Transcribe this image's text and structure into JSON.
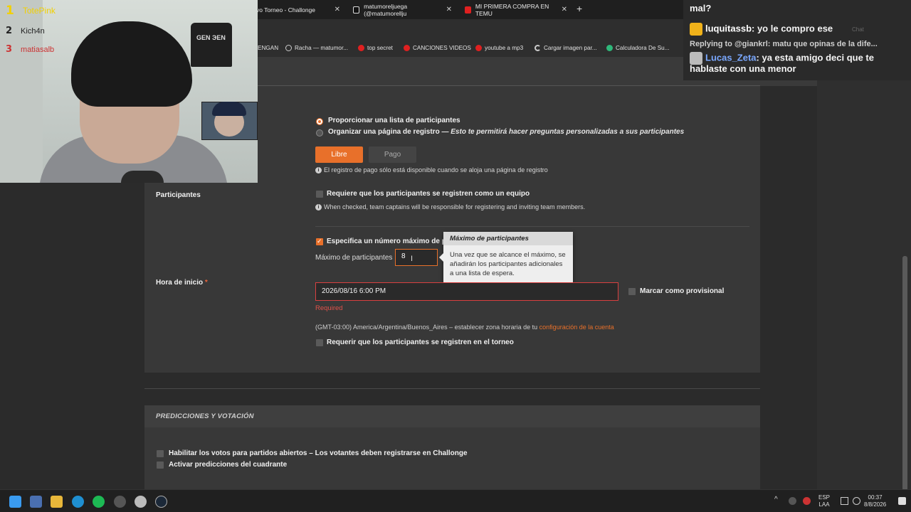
{
  "browser": {
    "tabs": [
      {
        "label": "vo Torneo - Challonge"
      },
      {
        "label": "matumoreljuega (@matumorellju"
      },
      {
        "label": "MI PRIMERA COMPRA EN TEMU"
      }
    ],
    "bookmarks": [
      {
        "label": "ENGAN"
      },
      {
        "label": "Racha — matumor..."
      },
      {
        "label": "top secret"
      },
      {
        "label": "CANCIONES VIDEOS"
      },
      {
        "label": "youtube a mp3"
      },
      {
        "label": "Cargar imagen par..."
      },
      {
        "label": "Calculadora De Su..."
      }
    ]
  },
  "form": {
    "participants_label": "Participantes",
    "radio_list": "Proporcionar una lista de participantes",
    "radio_reg_main": "Organizar una página de registro — ",
    "radio_reg_em": "Esto te permitirá hacer preguntas personalizadas a sus participantes",
    "btn_libre": "Libre",
    "btn_pago": "Pago",
    "pago_info": "El registro de pago sólo está disponible cuando se aloja una página de registro",
    "team_checkbox": "Requiere que los participantes se registren como un equipo",
    "team_info": "When checked, team captains will be responsible for registering and inviting team members.",
    "max_checkbox": "Especifica un número máximo de pa",
    "max_label": "Máximo de participantes",
    "max_value": "8",
    "tooltip_title": "Máximo de participantes",
    "tooltip_body": "Una vez que se alcance el máximo, se añadirán los participantes adicionales a una lista de espera.",
    "start_label": "Hora de inicio",
    "start_star": "*",
    "start_value": "2026/08/16 6:00 PM",
    "provisional": "Marcar como provisional",
    "required_msg": "Required",
    "tz_text": "(GMT-03:00) America/Argentina/Buenos_Aires – establecer zona horaria de tu ",
    "tz_link": "configuración de la cuenta",
    "register_checkbox": "Requerir que los participantes se registren en el torneo"
  },
  "predictions": {
    "title": "PREDICCIONES Y VOTACIÓN",
    "opt1": "Habilitar los votos para partidos abiertos – Los votantes deben registrarse en Challonge",
    "opt2": "Activar predicciones del cuadrante"
  },
  "overlay": {
    "leaderboard": [
      {
        "rank": "1",
        "name": "TotePink"
      },
      {
        "rank": "2",
        "name": "Kich4n"
      },
      {
        "rank": "3",
        "name": "matiasalb"
      }
    ],
    "shirt_text": "GEN ЭEN"
  },
  "chat": {
    "line0": "mal?",
    "line1_user": "luquitassb",
    "line1_msg": ": yo le compro ese",
    "reply_prefix": "Replying to ",
    "reply_user": "@giankrl",
    "reply_msg": ": matu que opinas de la dife...",
    "line2_user": "Lucas_Zeta",
    "line2_msg": ": ya esta amigo deci que te",
    "line2_cont": "hablaste con una menor",
    "ghost": "Chat"
  },
  "taskbar": {
    "lang_top": "ESP",
    "lang_bottom": "LAA",
    "time": "00:37",
    "date": "8/8/2026",
    "caret": "^"
  },
  "colors": {
    "accent": "#e8702a",
    "error": "#e0524a"
  }
}
